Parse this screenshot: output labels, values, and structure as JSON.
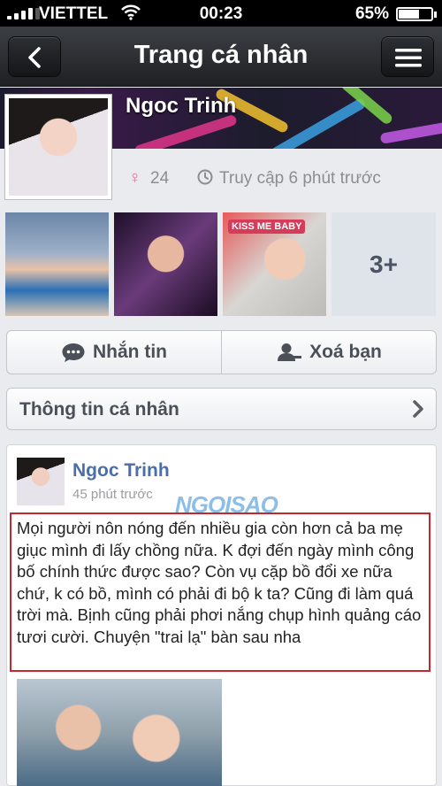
{
  "status_bar": {
    "carrier": "VIETTEL",
    "time": "00:23",
    "battery": "65%",
    "battery_level": 0.65
  },
  "nav": {
    "title": "Trang cá nhân"
  },
  "profile": {
    "name": "Ngoc Trinh",
    "age": "24",
    "last_visit": "Truy cập 6 phút trước",
    "more_photos": "3+",
    "photo3_tag": "KISS ME BABY"
  },
  "actions": {
    "message": "Nhắn tin",
    "unfriend": "Xoá bạn"
  },
  "info": {
    "label": "Thông tin cá nhân"
  },
  "post": {
    "author": "Ngoc Trinh",
    "time": "45 phút trước",
    "watermark": "NGOISAO",
    "body": "Mọi người nôn nóng đến nhiều gia còn hơn cả ba mẹ giục mình đi lấy chồng nữa. K đợi đến ngày mình công bố chính thức được sao? Còn vụ cặp bồ đổi xe nữa chứ, k có bồ, mình có phải đi bộ k ta? Cũng đi làm quá trời mà. Bịnh cũng phải phơi nắng chụp hình quảng cáo tươi cười. Chuyện \"trai lạ\" bàn sau nha"
  },
  "colors": {
    "nav_bg": "#2a2d31",
    "link": "#4a6ea9",
    "highlight_border": "#c8262c",
    "gender_icon": "#e86b9c"
  }
}
